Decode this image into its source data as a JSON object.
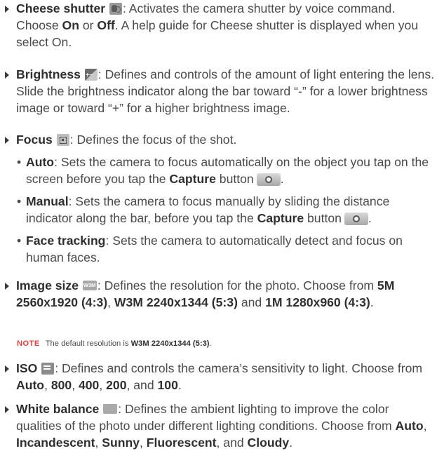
{
  "items": [
    {
      "name": "Cheese shutter",
      "icon": "cheese-shutter-icon",
      "text_1": ": Activates the camera shutter by voice command. Choose ",
      "opt_on": "On",
      "text_2": " or ",
      "opt_off": "Off",
      "text_3": ". A help guide for Cheese shutter is displayed when you select On."
    },
    {
      "name": "Brightness",
      "icon": "brightness-icon",
      "text": ": Defines and controls of the amount of light entering the lens. Slide the brightness indicator along the bar toward “-” for a lower brightness image or toward “+” for a higher brightness image."
    },
    {
      "name": "Focus",
      "icon": "focus-icon",
      "text": ": Defines the focus of the shot.",
      "sub": [
        {
          "name": "Auto",
          "text": ": Sets the camera to focus automatically on the object you tap on the screen before you tap the ",
          "button": "Capture",
          "after": " button"
        },
        {
          "name": "Manual",
          "text": ": Sets the camera to focus manually by sliding the distance indicator along the bar, before you tap the ",
          "button": "Capture",
          "after": " button"
        },
        {
          "name": "Face tracking",
          "text": ": Sets the camera to automatically detect and focus on human faces."
        }
      ]
    },
    {
      "name": "Image size",
      "icon": "image-size-icon",
      "icon_text": "W3M",
      "text_1": ": Defines the resolution for the photo. Choose from ",
      "opt_1": "5M 2560x1920 (4:3)",
      "sep_1": ", ",
      "opt_2": "W3M 2240x1344 (5:3)",
      "sep_2": " and ",
      "opt_3": "1M 1280x960 (4:3)",
      "end": "."
    },
    {
      "name": "ISO",
      "icon": "iso-icon",
      "text_1": ": Defines and controls the camera’s sensitivity to light. Choose from ",
      "opts": [
        "Auto",
        "800",
        "400",
        "200",
        "100"
      ],
      "sep": ", ",
      "last_sep": ", and ",
      "end": "."
    },
    {
      "name": "White balance",
      "icon": "white-balance-icon",
      "text_1": ": Defines the ambient lighting to improve the color qualities of the photo under different lighting conditions. Choose from ",
      "opts": [
        "Auto",
        "Incandescent",
        "Sunny",
        "Fluorescent",
        "Cloudy"
      ],
      "sep": ", ",
      "last_sep": ", and ",
      "end": "."
    }
  ],
  "note": {
    "label": "NOTE",
    "text": "The default resolution is ",
    "value": "W3M 2240x1344 (5:3)",
    "end": "."
  }
}
